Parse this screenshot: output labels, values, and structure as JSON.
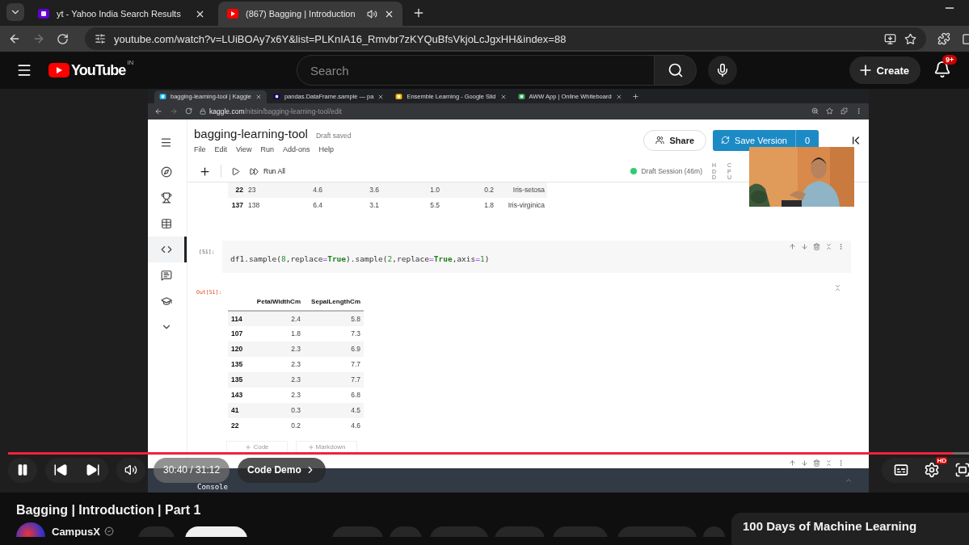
{
  "browser": {
    "tabs": [
      {
        "title": "yt - Yahoo India Search Results",
        "kind": "yahoo",
        "selected": false
      },
      {
        "title": "(867) Bagging | Introduction",
        "kind": "youtube",
        "selected": true
      }
    ],
    "url": "youtube.com/watch?v=LUiBOAy7x6Y&list=PLKnIA16_Rmvbr7zKYQuBfsVkjoLcJgxHH&index=88"
  },
  "youtube": {
    "logo": "YouTube",
    "region": "IN",
    "search_placeholder": "Search",
    "create": "Create",
    "notifications": "9+"
  },
  "screen": {
    "tabs": [
      {
        "title": "bagging-learning-tool | Kaggle",
        "kind": "kaggle",
        "selected": true
      },
      {
        "title": "pandas.DataFrame.sample — pa",
        "kind": "pandas",
        "selected": false
      },
      {
        "title": "Ensemble Learning - Google Slid",
        "kind": "slides",
        "selected": false
      },
      {
        "title": "AWW App | Online Whiteboard",
        "kind": "aww",
        "selected": false
      }
    ],
    "url_domain": "kaggle.com",
    "url_path": "/nitsin/bagging-learning-tool/edit",
    "notebook": {
      "title": "bagging-learning-tool",
      "status": "Draft saved",
      "menu": [
        "File",
        "Edit",
        "View",
        "Run",
        "Add-ons",
        "Help"
      ],
      "share": "Share",
      "save": "Save Version",
      "save_count": "0",
      "run_all": "Run All",
      "session": "Draft Session (46m)",
      "meter_labels": [
        "HDD",
        "CPU"
      ],
      "sidebar": [
        {
          "kind": "compass",
          "selected": false
        },
        {
          "kind": "trophy",
          "selected": false
        },
        {
          "kind": "table",
          "selected": false
        },
        {
          "kind": "code",
          "selected": true
        },
        {
          "kind": "comment",
          "selected": false
        },
        {
          "kind": "school",
          "selected": false
        },
        {
          "kind": "more",
          "selected": false
        }
      ],
      "previous_rows": [
        {
          "cells": [
            "22",
            "23",
            "4.6",
            "3.6",
            "1.0",
            "0.2",
            "Iris-setosa"
          ]
        },
        {
          "cells": [
            "137",
            "138",
            "6.4",
            "3.1",
            "5.5",
            "1.8",
            "Iris-virginica"
          ]
        }
      ],
      "cell": {
        "prompt": "[51]:",
        "code": [
          {
            "text": "df1.sample(",
            "kind": "plain"
          },
          {
            "text": "8",
            "kind": "number"
          },
          {
            "text": ",replace",
            "kind": "plain"
          },
          {
            "text": "=",
            "kind": "operator"
          },
          {
            "text": "True",
            "kind": "keyword"
          },
          {
            "text": ").sample(",
            "kind": "plain"
          },
          {
            "text": "2",
            "kind": "number"
          },
          {
            "text": ",replace",
            "kind": "plain"
          },
          {
            "text": "=",
            "kind": "operator"
          },
          {
            "text": "True",
            "kind": "keyword"
          },
          {
            "text": ",axis",
            "kind": "plain"
          },
          {
            "text": "=",
            "kind": "operator"
          },
          {
            "text": "1",
            "kind": "number"
          },
          {
            "text": ")",
            "kind": "plain"
          }
        ]
      },
      "output": {
        "prompt": "Out[51]:",
        "columns": [
          "PetalWidthCm",
          "SepalLengthCm"
        ],
        "rows": [
          {
            "index": "114",
            "values": [
              "2.4",
              "5.8"
            ]
          },
          {
            "index": "107",
            "values": [
              "1.8",
              "7.3"
            ]
          },
          {
            "index": "120",
            "values": [
              "2.3",
              "6.9"
            ]
          },
          {
            "index": "135",
            "values": [
              "2.3",
              "7.7"
            ]
          },
          {
            "index": "135",
            "values": [
              "2.3",
              "7.7"
            ]
          },
          {
            "index": "143",
            "values": [
              "2.3",
              "6.8"
            ]
          },
          {
            "index": "41",
            "values": [
              "0.3",
              "4.5"
            ]
          },
          {
            "index": "22",
            "values": [
              "0.2",
              "4.6"
            ]
          }
        ]
      },
      "add_buttons": [
        "Code",
        "Markdown"
      ],
      "console": "Console"
    }
  },
  "player": {
    "level": 0.983,
    "time": "30:40 / 31:12",
    "chapter": "Code Demo",
    "quality": "HD"
  },
  "video_title": "Bagging | Introduction | Part 1",
  "channel": {
    "name": "CampusX"
  },
  "playlist": {
    "title": "100 Days of Machine Learning"
  }
}
